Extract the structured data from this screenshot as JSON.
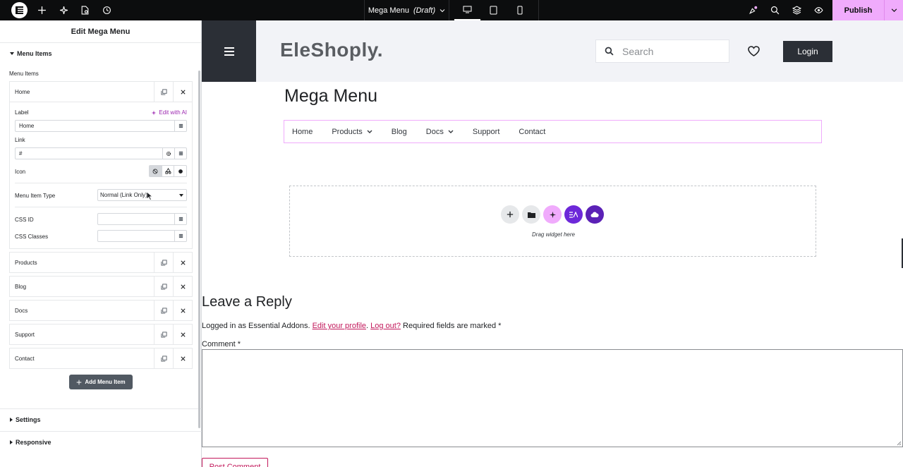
{
  "topbar": {
    "doc_title": "Mega Menu",
    "doc_status": "(Draft)",
    "publish_label": "Publish",
    "icons": [
      "elementor-logo-icon",
      "plus-icon",
      "ai-sparkle-icon",
      "page-settings-icon",
      "history-icon",
      "desktop-icon",
      "tablet-icon",
      "mobile-icon",
      "whats-new-icon",
      "search-icon",
      "structure-icon",
      "preview-icon",
      "chevron-down-icon"
    ]
  },
  "panel": {
    "title": "Edit Mega Menu",
    "section_menu_items": "Menu Items",
    "menu_items_label": "Menu Items",
    "expanded_item": {
      "name": "Home",
      "label_title": "Label",
      "edit_ai": "Edit with AI",
      "label_value": "Home",
      "link_title": "Link",
      "link_value": "#",
      "icon_title": "Icon",
      "type_title": "Menu Item Type",
      "type_value": "Normal (Link Only)",
      "css_id_title": "CSS ID",
      "css_classes_title": "CSS Classes"
    },
    "items": [
      "Products",
      "Blog",
      "Docs",
      "Support",
      "Contact"
    ],
    "add_item_label": "Add Menu Item",
    "section_settings": "Settings",
    "section_responsive": "Responsive"
  },
  "site": {
    "logo": "EleShoply.",
    "search_placeholder": "Search",
    "login_label": "Login",
    "page_title": "Mega Menu",
    "nav": [
      "Home",
      "Products",
      "Blog",
      "Docs",
      "Support",
      "Contact"
    ],
    "drag_text": "Drag widget here",
    "reply_title": "Leave a Reply",
    "logged_prefix": "Logged in as Essential Addons.",
    "edit_profile": "Edit your profile",
    "logout": "Log out?",
    "required_note": "Required fields are marked *",
    "comment_label": "Comment *",
    "post_comment": "Post Comment"
  },
  "colors": {
    "accent_pink": "#f0abfc",
    "link_red": "#c2185b",
    "dark_button": "#2b2f36",
    "purple": "#6d28d9"
  }
}
